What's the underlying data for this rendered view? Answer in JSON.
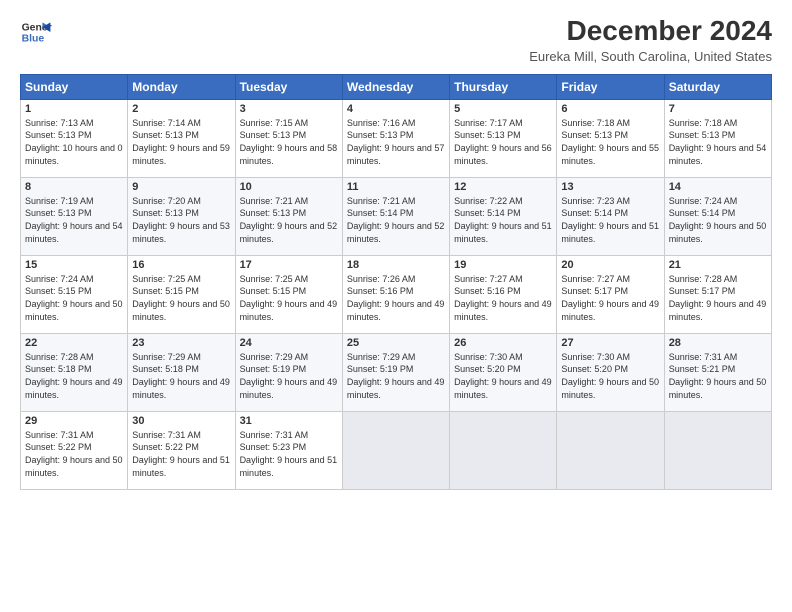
{
  "logo": {
    "line1": "General",
    "line2": "Blue"
  },
  "title": "December 2024",
  "subtitle": "Eureka Mill, South Carolina, United States",
  "days_of_week": [
    "Sunday",
    "Monday",
    "Tuesday",
    "Wednesday",
    "Thursday",
    "Friday",
    "Saturday"
  ],
  "weeks": [
    [
      {
        "day": "1",
        "sunrise": "7:13 AM",
        "sunset": "5:13 PM",
        "daylight": "10 hours and 0 minutes."
      },
      {
        "day": "2",
        "sunrise": "7:14 AM",
        "sunset": "5:13 PM",
        "daylight": "9 hours and 59 minutes."
      },
      {
        "day": "3",
        "sunrise": "7:15 AM",
        "sunset": "5:13 PM",
        "daylight": "9 hours and 58 minutes."
      },
      {
        "day": "4",
        "sunrise": "7:16 AM",
        "sunset": "5:13 PM",
        "daylight": "9 hours and 57 minutes."
      },
      {
        "day": "5",
        "sunrise": "7:17 AM",
        "sunset": "5:13 PM",
        "daylight": "9 hours and 56 minutes."
      },
      {
        "day": "6",
        "sunrise": "7:18 AM",
        "sunset": "5:13 PM",
        "daylight": "9 hours and 55 minutes."
      },
      {
        "day": "7",
        "sunrise": "7:18 AM",
        "sunset": "5:13 PM",
        "daylight": "9 hours and 54 minutes."
      }
    ],
    [
      {
        "day": "8",
        "sunrise": "7:19 AM",
        "sunset": "5:13 PM",
        "daylight": "9 hours and 54 minutes."
      },
      {
        "day": "9",
        "sunrise": "7:20 AM",
        "sunset": "5:13 PM",
        "daylight": "9 hours and 53 minutes."
      },
      {
        "day": "10",
        "sunrise": "7:21 AM",
        "sunset": "5:13 PM",
        "daylight": "9 hours and 52 minutes."
      },
      {
        "day": "11",
        "sunrise": "7:21 AM",
        "sunset": "5:14 PM",
        "daylight": "9 hours and 52 minutes."
      },
      {
        "day": "12",
        "sunrise": "7:22 AM",
        "sunset": "5:14 PM",
        "daylight": "9 hours and 51 minutes."
      },
      {
        "day": "13",
        "sunrise": "7:23 AM",
        "sunset": "5:14 PM",
        "daylight": "9 hours and 51 minutes."
      },
      {
        "day": "14",
        "sunrise": "7:24 AM",
        "sunset": "5:14 PM",
        "daylight": "9 hours and 50 minutes."
      }
    ],
    [
      {
        "day": "15",
        "sunrise": "7:24 AM",
        "sunset": "5:15 PM",
        "daylight": "9 hours and 50 minutes."
      },
      {
        "day": "16",
        "sunrise": "7:25 AM",
        "sunset": "5:15 PM",
        "daylight": "9 hours and 50 minutes."
      },
      {
        "day": "17",
        "sunrise": "7:25 AM",
        "sunset": "5:15 PM",
        "daylight": "9 hours and 49 minutes."
      },
      {
        "day": "18",
        "sunrise": "7:26 AM",
        "sunset": "5:16 PM",
        "daylight": "9 hours and 49 minutes."
      },
      {
        "day": "19",
        "sunrise": "7:27 AM",
        "sunset": "5:16 PM",
        "daylight": "9 hours and 49 minutes."
      },
      {
        "day": "20",
        "sunrise": "7:27 AM",
        "sunset": "5:17 PM",
        "daylight": "9 hours and 49 minutes."
      },
      {
        "day": "21",
        "sunrise": "7:28 AM",
        "sunset": "5:17 PM",
        "daylight": "9 hours and 49 minutes."
      }
    ],
    [
      {
        "day": "22",
        "sunrise": "7:28 AM",
        "sunset": "5:18 PM",
        "daylight": "9 hours and 49 minutes."
      },
      {
        "day": "23",
        "sunrise": "7:29 AM",
        "sunset": "5:18 PM",
        "daylight": "9 hours and 49 minutes."
      },
      {
        "day": "24",
        "sunrise": "7:29 AM",
        "sunset": "5:19 PM",
        "daylight": "9 hours and 49 minutes."
      },
      {
        "day": "25",
        "sunrise": "7:29 AM",
        "sunset": "5:19 PM",
        "daylight": "9 hours and 49 minutes."
      },
      {
        "day": "26",
        "sunrise": "7:30 AM",
        "sunset": "5:20 PM",
        "daylight": "9 hours and 49 minutes."
      },
      {
        "day": "27",
        "sunrise": "7:30 AM",
        "sunset": "5:20 PM",
        "daylight": "9 hours and 50 minutes."
      },
      {
        "day": "28",
        "sunrise": "7:31 AM",
        "sunset": "5:21 PM",
        "daylight": "9 hours and 50 minutes."
      }
    ],
    [
      {
        "day": "29",
        "sunrise": "7:31 AM",
        "sunset": "5:22 PM",
        "daylight": "9 hours and 50 minutes."
      },
      {
        "day": "30",
        "sunrise": "7:31 AM",
        "sunset": "5:22 PM",
        "daylight": "9 hours and 51 minutes."
      },
      {
        "day": "31",
        "sunrise": "7:31 AM",
        "sunset": "5:23 PM",
        "daylight": "9 hours and 51 minutes."
      },
      null,
      null,
      null,
      null
    ]
  ]
}
